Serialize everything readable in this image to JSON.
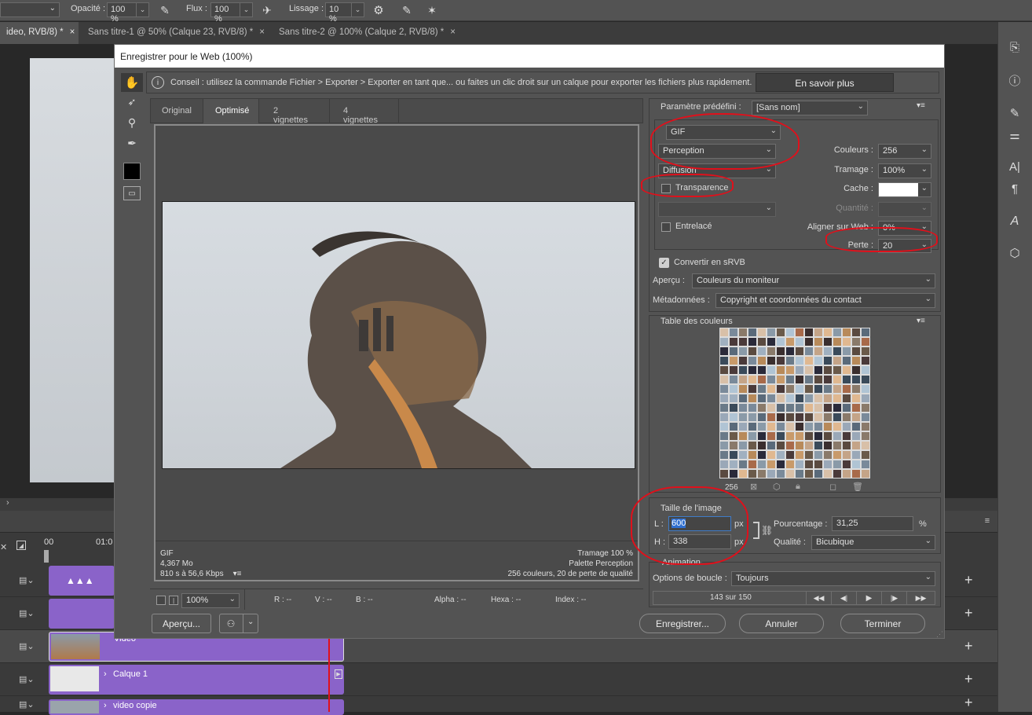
{
  "topbar": {
    "opacity_label": "Opacité :",
    "opacity_value": "100 %",
    "flow_label": "Flux :",
    "flow_value": "100 %",
    "smoothing_label": "Lissage :",
    "smoothing_value": "10 %"
  },
  "tabs": [
    {
      "label": "ideo, RVB/8) *"
    },
    {
      "label": "Sans titre-1 @ 50% (Calque 23, RVB/8) *"
    },
    {
      "label": "Sans titre-2 @ 100% (Calque 2, RVB/8) *"
    }
  ],
  "dialog": {
    "title": "Enregistrer pour le Web (100%)",
    "tip": "Conseil : utilisez la commande Fichier > Exporter > Exporter en tant que... ou faites un clic droit sur un calque pour exporter les fichiers plus rapidement.",
    "learn_more": "En savoir plus",
    "view_tabs": [
      "Original",
      "Optimisé",
      "2 vignettes",
      "4 vignettes"
    ],
    "info_left": {
      "format": "GIF",
      "size": "4,367 Mo",
      "time": "810 s à 56,6 Kbps"
    },
    "info_right": {
      "dither": "Tramage 100 %",
      "palette": "Palette Perception",
      "colors": "256 couleurs, 20 de perte de qualité"
    },
    "statusbar": {
      "zoom": "100%",
      "r": "R : --",
      "v": "V : --",
      "b": "B : --",
      "alpha": "Alpha : --",
      "hexa": "Hexa : --",
      "index": "Index : --"
    },
    "preset_label": "Paramètre prédéfini :",
    "preset_value": "[Sans nom]",
    "format": "GIF",
    "reduction": "Perception",
    "dither_algo": "Diffusion",
    "transparency": "Transparence",
    "interlaced": "Entrelacé",
    "colors_label": "Couleurs :",
    "colors_value": "256",
    "dither_label": "Tramage :",
    "dither_value": "100%",
    "matte_label": "Cache :",
    "quantity_label": "Quantité :",
    "websnap_label": "Aligner sur Web :",
    "websnap_value": "0%",
    "lossy_label": "Perte :",
    "lossy_value": "20",
    "srgb": "Convertir en sRVB",
    "preview_label": "Aperçu :",
    "preview_value": "Couleurs du moniteur",
    "meta_label": "Métadonnées :",
    "meta_value": "Copyright et coordonnées du contact",
    "color_table_label": "Table des couleurs",
    "color_count": "256",
    "image_size_label": "Taille de l'image",
    "w_label": "L :",
    "w_value": "600",
    "h_label": "H :",
    "h_value": "338",
    "px": "px",
    "percent_label": "Pourcentage :",
    "percent_value": "31,25",
    "percent_unit": "%",
    "quality_label": "Qualité :",
    "quality_value": "Bicubique",
    "animation_label": "Animation",
    "loop_label": "Options de boucle :",
    "loop_value": "Toujours",
    "frame_counter": "143 sur 150",
    "preview_btn": "Aperçu...",
    "save_btn": "Enregistrer...",
    "cancel_btn": "Annuler",
    "done_btn": "Terminer"
  },
  "timeline": {
    "time0": "00",
    "time1": "01:0",
    "layers": [
      "Vidéo",
      "Calque 1",
      "video copie"
    ]
  },
  "colors": {
    "accent_red": "#e0101b",
    "purple": "#8a63c9",
    "panel": "#535353"
  }
}
